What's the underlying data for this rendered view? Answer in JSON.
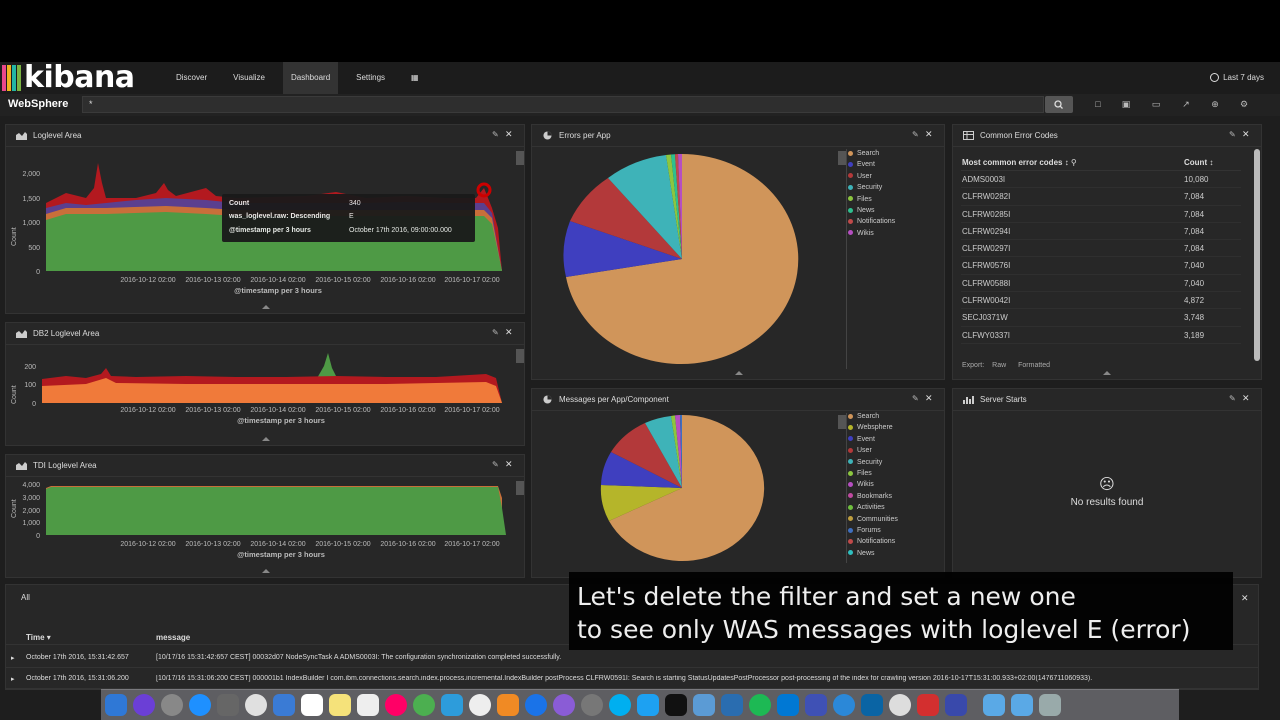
{
  "app": {
    "logo_text": "kibana",
    "nav": [
      "Discover",
      "Visualize",
      "Dashboard",
      "Settings"
    ],
    "active_nav": "Dashboard",
    "apps_icon": "grid-icon",
    "time_range": "Last 7 days"
  },
  "search": {
    "dashboard_title": "WebSphere",
    "query": "*"
  },
  "toolbar_icons": [
    "new-dashboard-icon",
    "save-icon",
    "open-icon",
    "share-icon",
    "add-panel-icon",
    "options-icon"
  ],
  "panels": {
    "loglevel": {
      "title": "Loglevel Area",
      "ylabel": "Count",
      "xlabel": "@timestamp per 3 hours",
      "yticks": [
        "2,000",
        "1,500",
        "1,000",
        "500",
        "0"
      ],
      "xticks": [
        "2016-10-12 02:00",
        "2016-10-13 02:00",
        "2016-10-14 02:00",
        "2016-10-15 02:00",
        "2016-10-16 02:00",
        "2016-10-17 02:00"
      ]
    },
    "db2": {
      "title": "DB2 Loglevel Area",
      "ylabel": "Count",
      "xlabel": "@timestamp per 3 hours",
      "yticks": [
        "200",
        "100",
        "0"
      ],
      "xticks": [
        "2016-10-12 02:00",
        "2016-10-13 02:00",
        "2016-10-14 02:00",
        "2016-10-15 02:00",
        "2016-10-16 02:00",
        "2016-10-17 02:00"
      ]
    },
    "tdi": {
      "title": "TDI Loglevel Area",
      "ylabel": "Count",
      "xlabel": "@timestamp per 3 hours",
      "yticks": [
        "4,000",
        "3,000",
        "2,000",
        "1,000",
        "0"
      ],
      "xticks": [
        "2016-10-12 02:00",
        "2016-10-13 02:00",
        "2016-10-14 02:00",
        "2016-10-15 02:00",
        "2016-10-16 02:00",
        "2016-10-17 02:00"
      ]
    },
    "errors_per_app": {
      "title": "Errors per App",
      "legend": [
        {
          "label": "Search",
          "color": "#d0955a"
        },
        {
          "label": "Event",
          "color": "#3f3fbf"
        },
        {
          "label": "User",
          "color": "#b3393a"
        },
        {
          "label": "Security",
          "color": "#3eb3b8"
        },
        {
          "label": "Files",
          "color": "#8cc63f"
        },
        {
          "label": "News",
          "color": "#2fbf8f"
        },
        {
          "label": "Notifications",
          "color": "#c04a4a"
        },
        {
          "label": "Wikis",
          "color": "#b64fc1"
        }
      ]
    },
    "messages_per_app": {
      "title": "Messages per App/Component",
      "legend": [
        {
          "label": "Search",
          "color": "#d0955a"
        },
        {
          "label": "Websphere",
          "color": "#b5b52a"
        },
        {
          "label": "Event",
          "color": "#3f3fbf"
        },
        {
          "label": "User",
          "color": "#b3393a"
        },
        {
          "label": "Security",
          "color": "#3eb3b8"
        },
        {
          "label": "Files",
          "color": "#8cc63f"
        },
        {
          "label": "Wikis",
          "color": "#b64fc1"
        },
        {
          "label": "Bookmarks",
          "color": "#c04aa0"
        },
        {
          "label": "Activities",
          "color": "#6fbf3f"
        },
        {
          "label": "Communities",
          "color": "#bf9f3f"
        },
        {
          "label": "Forums",
          "color": "#3f6fbf"
        },
        {
          "label": "Notifications",
          "color": "#c04a4a"
        },
        {
          "label": "News",
          "color": "#2fbfbf"
        }
      ]
    },
    "common_errors": {
      "title": "Common Error Codes",
      "col1": "Most common error codes",
      "col2": "Count",
      "rows": [
        {
          "code": "ADMS0003I",
          "count": "10,080"
        },
        {
          "code": "CLFRW0282I",
          "count": "7,084"
        },
        {
          "code": "CLFRW0285I",
          "count": "7,084"
        },
        {
          "code": "CLFRW0294I",
          "count": "7,084"
        },
        {
          "code": "CLFRW0297I",
          "count": "7,084"
        },
        {
          "code": "CLFRW0576I",
          "count": "7,040"
        },
        {
          "code": "CLFRW0588I",
          "count": "7,040"
        },
        {
          "code": "CLFRW0042I",
          "count": "4,872"
        },
        {
          "code": "SECJ0371W",
          "count": "3,748"
        },
        {
          "code": "CLFWY0337I",
          "count": "3,189"
        }
      ],
      "export_label": "Export:",
      "export_raw": "Raw",
      "export_formatted": "Formatted"
    },
    "server_starts": {
      "title": "Server Starts",
      "empty_text": "No results found"
    },
    "all_logs": {
      "title": "All",
      "col_time": "Time",
      "col_message": "message",
      "rows": [
        {
          "time": "October 17th 2016, 15:31:42.657",
          "message": "[10/17/16 15:31:42:657 CEST] 00032d07 NodeSyncTask A   ADMS0003I: The configuration synchronization completed successfully."
        },
        {
          "time": "October 17th 2016, 15:31:06.200",
          "message": "[10/17/16 15:31:06:200 CEST] 000001b1 IndexBuilder  I com.ibm.connections.search.index.process.incremental.IndexBuilder postProcess CLFRW0591I: Search is starting StatusUpdatesPostProcessor post-processing of the index for crawling version 2016-10-17T15:31:00.933+02:00(1476711060933)."
        }
      ]
    }
  },
  "tooltip": {
    "rows": [
      {
        "key": "Count",
        "value": "340"
      },
      {
        "key": "was_loglevel.raw: Descending",
        "value": "E"
      },
      {
        "key": "@timestamp per 3 hours",
        "value": "October 17th 2016, 09:00:00.000"
      }
    ]
  },
  "caption": {
    "line1": "Let's delete the filter and set a new one",
    "line2": "to see only WAS messages with loglevel E (error)"
  },
  "colors": {
    "green": "#4e9a45",
    "orange": "#f07a3a",
    "red": "#b3191f",
    "purple": "#5b3f8f",
    "pie_search": "#d0955a"
  }
}
